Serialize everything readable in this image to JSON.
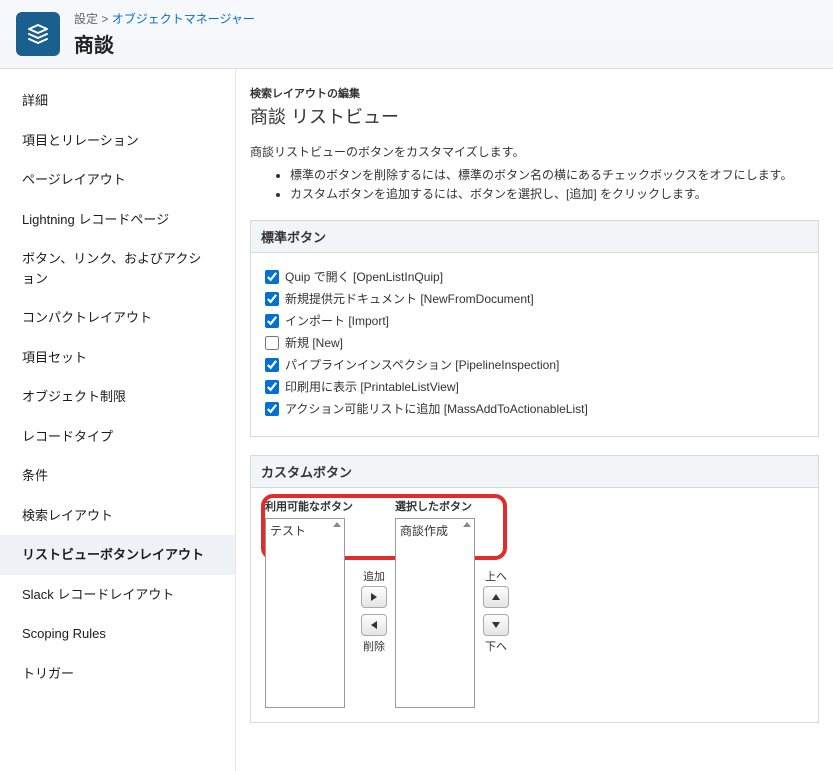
{
  "breadcrumb": {
    "setup": "設定",
    "sep": " > ",
    "object_manager": "オブジェクトマネージャー"
  },
  "page_title": "商談",
  "sidebar": {
    "items": [
      {
        "label": "詳細"
      },
      {
        "label": "項目とリレーション"
      },
      {
        "label": "ページレイアウト"
      },
      {
        "label": "Lightning レコードページ"
      },
      {
        "label": "ボタン、リンク、およびアクション"
      },
      {
        "label": "コンパクトレイアウト"
      },
      {
        "label": "項目セット"
      },
      {
        "label": "オブジェクト制限"
      },
      {
        "label": "レコードタイプ"
      },
      {
        "label": "条件"
      },
      {
        "label": "検索レイアウト"
      },
      {
        "label": "リストビューボタンレイアウト",
        "active": true
      },
      {
        "label": "Slack レコードレイアウト"
      },
      {
        "label": "Scoping Rules"
      },
      {
        "label": "トリガー"
      }
    ]
  },
  "main": {
    "edit_label": "検索レイアウトの編集",
    "title": "商談 リストビュー",
    "desc": "商談リストビューのボタンをカスタマイズします。",
    "bullets": [
      "標準のボタンを削除するには、標準のボタン名の横にあるチェックボックスをオフにします。",
      "カスタムボタンを追加するには、ボタンを選択し、[追加] をクリックします。"
    ]
  },
  "standard": {
    "header": "標準ボタン",
    "items": [
      {
        "label": "Quip で開く [OpenListInQuip]",
        "checked": true
      },
      {
        "label": "新規提供元ドキュメント [NewFromDocument]",
        "checked": true
      },
      {
        "label": "インポート [Import]",
        "checked": true
      },
      {
        "label": "新規 [New]",
        "checked": false
      },
      {
        "label": "パイプラインインスペクション [PipelineInspection]",
        "checked": true
      },
      {
        "label": "印刷用に表示 [PrintableListView]",
        "checked": true
      },
      {
        "label": "アクション可能リストに追加 [MassAddToActionableList]",
        "checked": true
      }
    ]
  },
  "custom": {
    "header": "カスタムボタン",
    "available_label": "利用可能なボタン",
    "selected_label": "選択したボタン",
    "available": [
      "テスト"
    ],
    "selected": [
      "商談作成"
    ],
    "add_label": "追加",
    "remove_label": "削除",
    "up_label": "上へ",
    "down_label": "下へ"
  }
}
